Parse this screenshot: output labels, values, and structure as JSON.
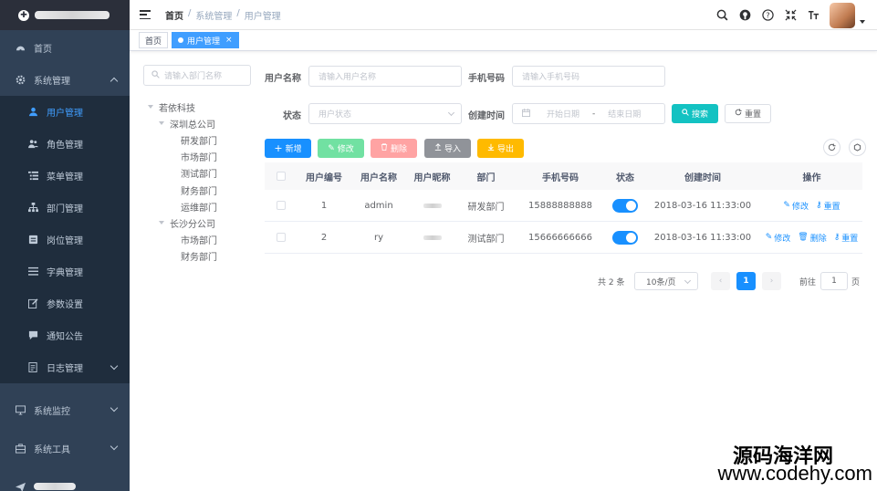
{
  "sidebar": {
    "items": [
      {
        "label": "首页",
        "icon": "dashboard-icon"
      },
      {
        "label": "系统管理",
        "icon": "gear-icon",
        "expanded": true
      }
    ],
    "submenu": [
      {
        "label": "用户管理",
        "icon": "user-icon",
        "active": true
      },
      {
        "label": "角色管理",
        "icon": "peoples-icon"
      },
      {
        "label": "菜单管理",
        "icon": "tree-table-icon"
      },
      {
        "label": "部门管理",
        "icon": "tree-icon"
      },
      {
        "label": "岗位管理",
        "icon": "post-icon"
      },
      {
        "label": "字典管理",
        "icon": "dict-icon"
      },
      {
        "label": "参数设置",
        "icon": "edit-icon"
      },
      {
        "label": "通知公告",
        "icon": "message-icon"
      },
      {
        "label": "日志管理",
        "icon": "log-icon"
      }
    ],
    "lower": [
      {
        "label": "系统监控",
        "icon": "monitor-icon"
      },
      {
        "label": "系统工具",
        "icon": "tool-icon"
      }
    ]
  },
  "breadcrumb": [
    "首页",
    "系统管理",
    "用户管理"
  ],
  "breadcrumb_sep": "/",
  "tags": [
    {
      "label": "首页"
    },
    {
      "label": "用户管理",
      "close": "×"
    }
  ],
  "dept": {
    "search_placeholder": "请输入部门名称",
    "tree": [
      {
        "label": "若依科技",
        "level": 0,
        "expandable": true
      },
      {
        "label": "深圳总公司",
        "level": 1,
        "expandable": true
      },
      {
        "label": "研发部门",
        "level": 2
      },
      {
        "label": "市场部门",
        "level": 2
      },
      {
        "label": "测试部门",
        "level": 2
      },
      {
        "label": "财务部门",
        "level": 2
      },
      {
        "label": "运维部门",
        "level": 2
      },
      {
        "label": "长沙分公司",
        "level": 1,
        "expandable": true
      },
      {
        "label": "市场部门",
        "level": 2
      },
      {
        "label": "财务部门",
        "level": 2
      }
    ]
  },
  "form": {
    "username_label": "用户名称",
    "username_placeholder": "请输入用户名称",
    "phone_label": "手机号码",
    "phone_placeholder": "请输入手机号码",
    "status_label": "状态",
    "status_placeholder": "用户状态",
    "time_label": "创建时间",
    "start_placeholder": "开始日期",
    "range_sep": "-",
    "end_placeholder": "结束日期",
    "search_btn": "搜索",
    "reset_btn": "重置"
  },
  "toolbar": {
    "add": "新增",
    "edit": "修改",
    "delete": "删除",
    "import": "导入",
    "export": "导出"
  },
  "table": {
    "headers": [
      "用户编号",
      "用户名称",
      "用户昵称",
      "部门",
      "手机号码",
      "状态",
      "创建时间",
      "操作"
    ],
    "rows": [
      {
        "id": "1",
        "name": "admin",
        "dept": "研发部门",
        "phone": "15888888888",
        "enabled": true,
        "time": "2018-03-16 11:33:00",
        "ops": [
          "修改",
          "重置"
        ]
      },
      {
        "id": "2",
        "name": "ry",
        "dept": "测试部门",
        "phone": "15666666666",
        "enabled": true,
        "time": "2018-03-16 11:33:00",
        "ops": [
          "修改",
          "删除",
          "重置"
        ]
      }
    ]
  },
  "pagination": {
    "total": "共 2 条",
    "page_size": "10条/页",
    "current": "1",
    "goto_label": "前往",
    "goto_value": "1",
    "page_unit": "页"
  },
  "watermark": {
    "line1": "源码海洋网",
    "line2": "www.codehy.com"
  },
  "colors": {
    "sidebar_bg": "#304156",
    "submenu_bg": "#1f2d3d",
    "primary": "#1890ff",
    "search": "#13c2c2",
    "warning": "#ffba00"
  }
}
